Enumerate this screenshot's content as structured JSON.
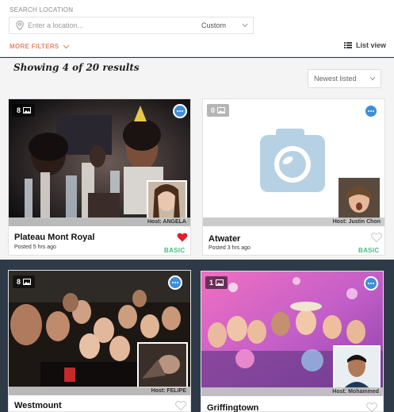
{
  "search": {
    "label": "SEARCH LOCATION",
    "placeholder": "Enter a location...",
    "range_value": "Custom"
  },
  "filters": {
    "more_filters_label": "MORE FILTERS",
    "list_view_label": "List view"
  },
  "results": {
    "summary": "Showing 4 of 20 results",
    "sort_value": "Newest listed"
  },
  "listings": [
    {
      "photo_count": "8",
      "host": "Host: ANGELA",
      "title": "Plateau Mont Royal",
      "posted": "Posted 5 hrs ago",
      "badge": "BASIC",
      "favorited": true
    },
    {
      "photo_count": "0",
      "host": "Host: Justin Chon",
      "title": "Atwater",
      "posted": "Posted 3 hrs ago",
      "badge": "BASIC",
      "favorited": false
    },
    {
      "photo_count": "8",
      "host": "Host: FELIPE",
      "title": "Westmount",
      "favorited": false
    },
    {
      "photo_count": "1",
      "host": "Host: Mohammed",
      "title": "Griffingtown",
      "favorited": false
    }
  ],
  "colors": {
    "accent_orange": "#e8856a",
    "badge_green": "#3fbf7f",
    "heart_red": "#e0202c",
    "chat_blue": "#3f8fd6"
  }
}
